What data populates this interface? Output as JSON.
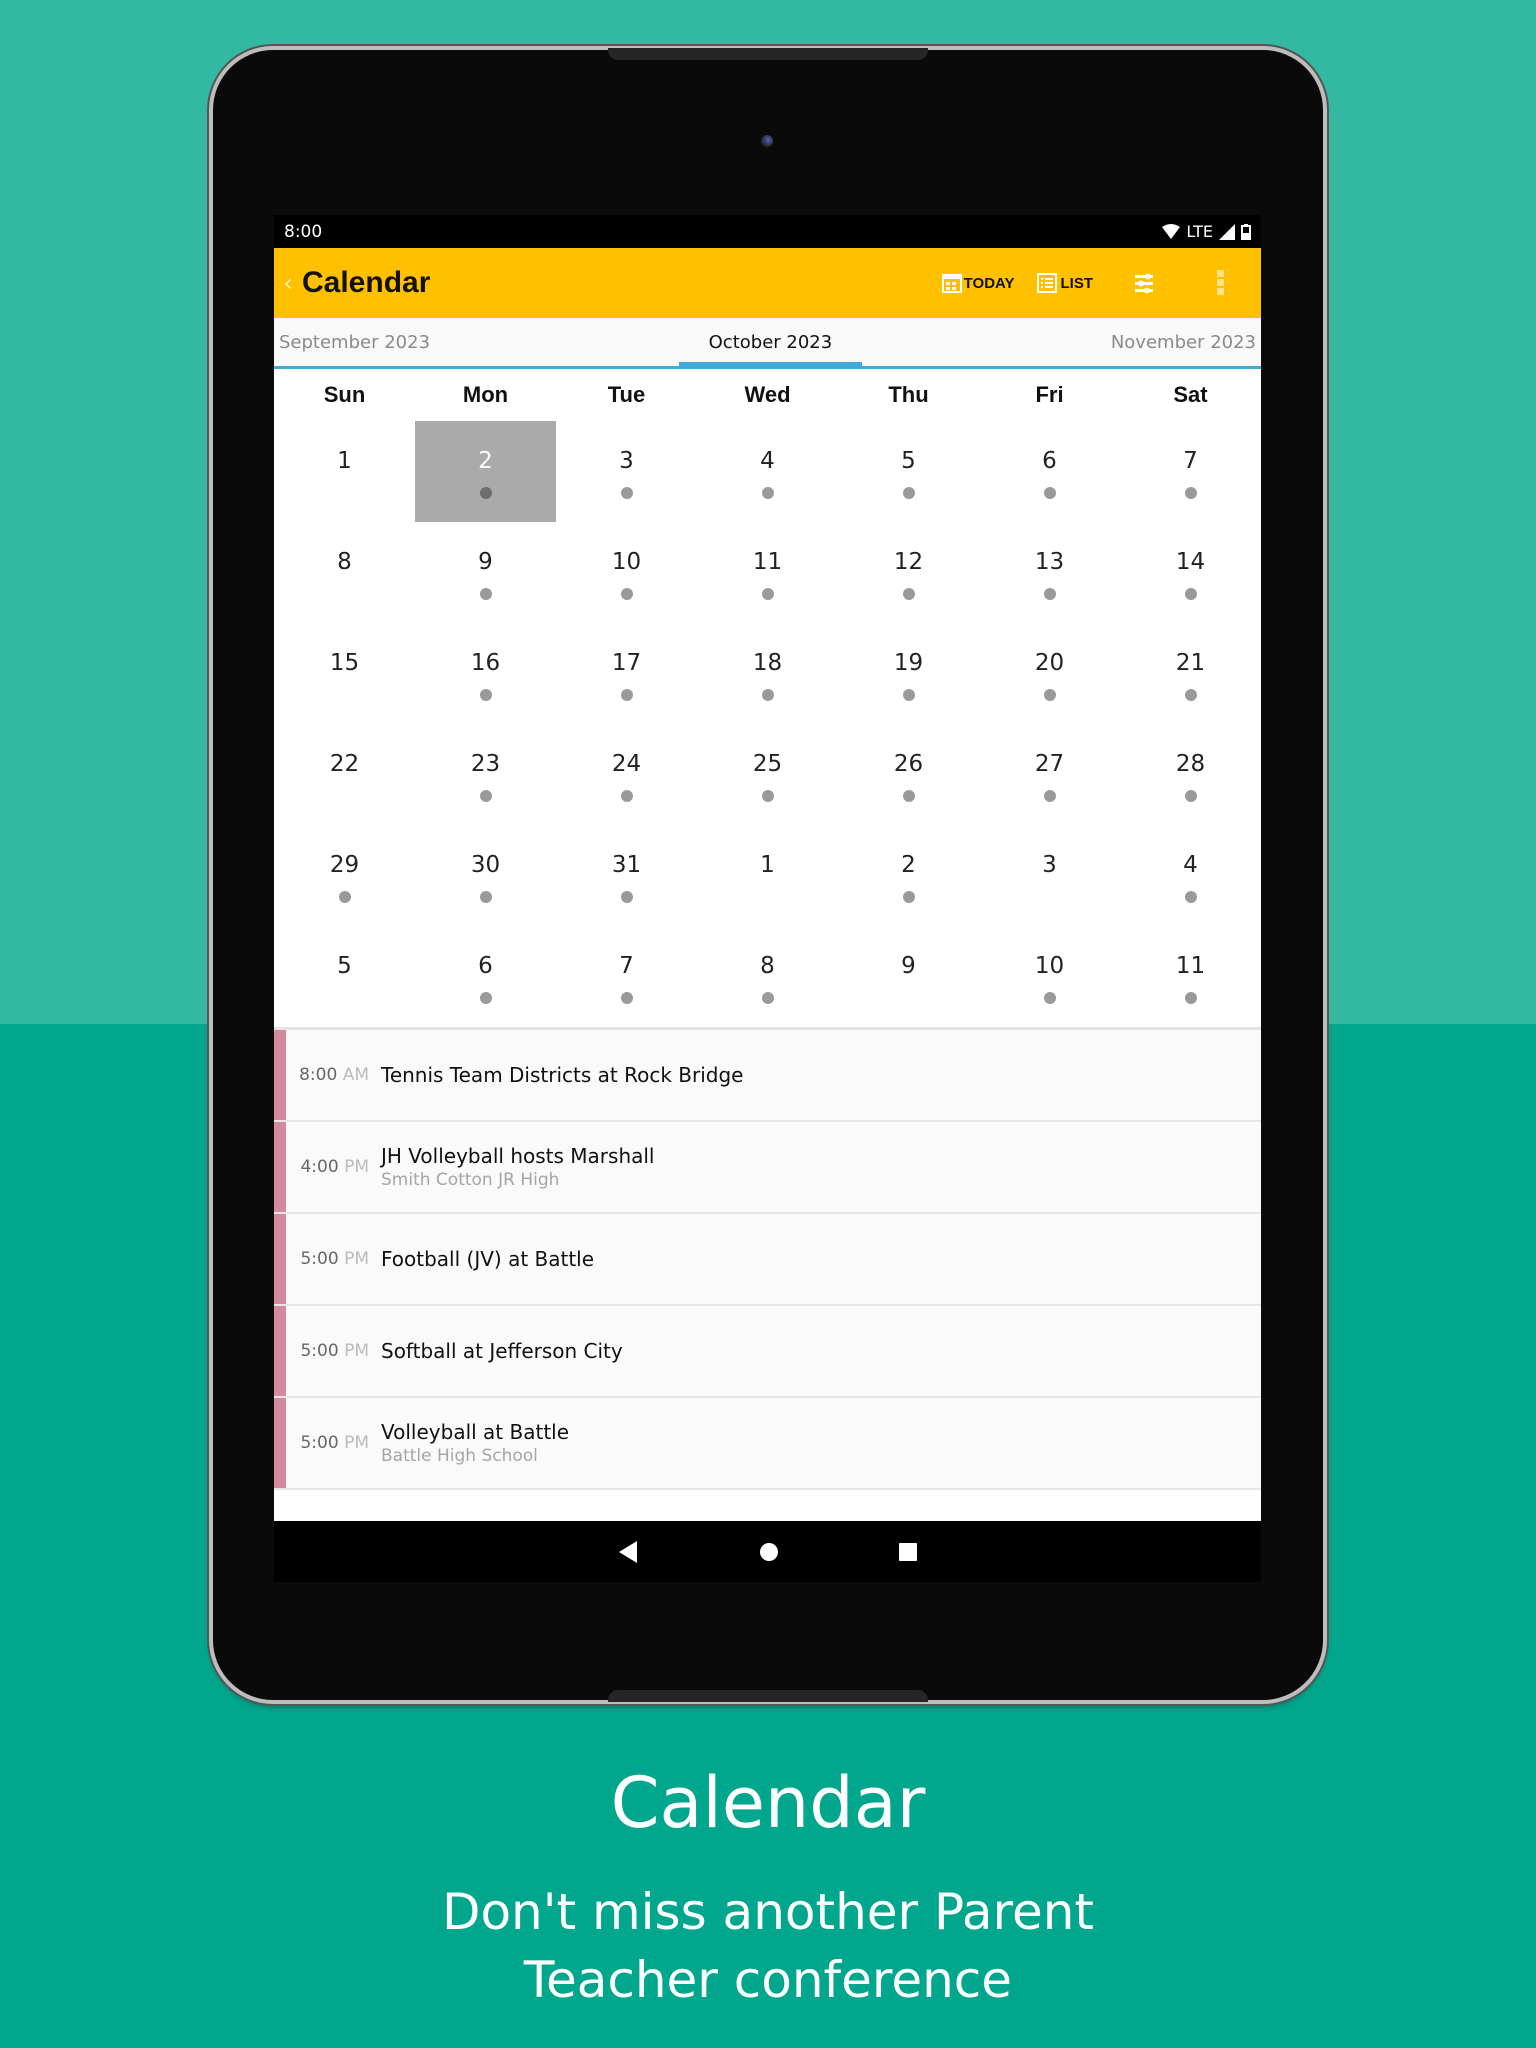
{
  "status_bar": {
    "time": "8:00",
    "network": "LTE"
  },
  "app_bar": {
    "title": "Calendar",
    "today_label": "TODAY",
    "list_label": "LIST",
    "accent_color": "#FFC000"
  },
  "month_tabs": {
    "previous": "September 2023",
    "current": "October 2023",
    "next": "November 2023"
  },
  "weekdays": [
    "Sun",
    "Mon",
    "Tue",
    "Wed",
    "Thu",
    "Fri",
    "Sat"
  ],
  "calendar": {
    "selected_day": "2",
    "weeks": [
      [
        {
          "d": "1",
          "e": false
        },
        {
          "d": "2",
          "e": true,
          "sel": true
        },
        {
          "d": "3",
          "e": true
        },
        {
          "d": "4",
          "e": true
        },
        {
          "d": "5",
          "e": true
        },
        {
          "d": "6",
          "e": true
        },
        {
          "d": "7",
          "e": true
        }
      ],
      [
        {
          "d": "8",
          "e": false
        },
        {
          "d": "9",
          "e": true
        },
        {
          "d": "10",
          "e": true
        },
        {
          "d": "11",
          "e": true
        },
        {
          "d": "12",
          "e": true
        },
        {
          "d": "13",
          "e": true
        },
        {
          "d": "14",
          "e": true
        }
      ],
      [
        {
          "d": "15",
          "e": false
        },
        {
          "d": "16",
          "e": true
        },
        {
          "d": "17",
          "e": true
        },
        {
          "d": "18",
          "e": true
        },
        {
          "d": "19",
          "e": true
        },
        {
          "d": "20",
          "e": true
        },
        {
          "d": "21",
          "e": true
        }
      ],
      [
        {
          "d": "22",
          "e": false
        },
        {
          "d": "23",
          "e": true
        },
        {
          "d": "24",
          "e": true
        },
        {
          "d": "25",
          "e": true
        },
        {
          "d": "26",
          "e": true
        },
        {
          "d": "27",
          "e": true
        },
        {
          "d": "28",
          "e": true
        }
      ],
      [
        {
          "d": "29",
          "e": true
        },
        {
          "d": "30",
          "e": true
        },
        {
          "d": "31",
          "e": true
        },
        {
          "d": "1",
          "e": false
        },
        {
          "d": "2",
          "e": true
        },
        {
          "d": "3",
          "e": false
        },
        {
          "d": "4",
          "e": true
        }
      ],
      [
        {
          "d": "5",
          "e": false
        },
        {
          "d": "6",
          "e": true
        },
        {
          "d": "7",
          "e": true
        },
        {
          "d": "8",
          "e": true
        },
        {
          "d": "9",
          "e": false
        },
        {
          "d": "10",
          "e": true
        },
        {
          "d": "11",
          "e": true
        }
      ]
    ]
  },
  "events": [
    {
      "time": "8:00",
      "ampm": "AM",
      "title": "Tennis Team Districts at Rock Bridge",
      "location": ""
    },
    {
      "time": "4:00",
      "ampm": "PM",
      "title": "JH Volleyball hosts Marshall",
      "location": "Smith Cotton JR High"
    },
    {
      "time": "5:00",
      "ampm": "PM",
      "title": "Football (JV) at Battle",
      "location": ""
    },
    {
      "time": "5:00",
      "ampm": "PM",
      "title": "Softball at Jefferson City",
      "location": ""
    },
    {
      "time": "5:00",
      "ampm": "PM",
      "title": "Volleyball at Battle",
      "location": "Battle High School"
    }
  ],
  "event_color": "#D4899C",
  "promo": {
    "title": "Calendar",
    "subtitle_line1": "Don't miss another Parent",
    "subtitle_line2": "Teacher conference"
  }
}
